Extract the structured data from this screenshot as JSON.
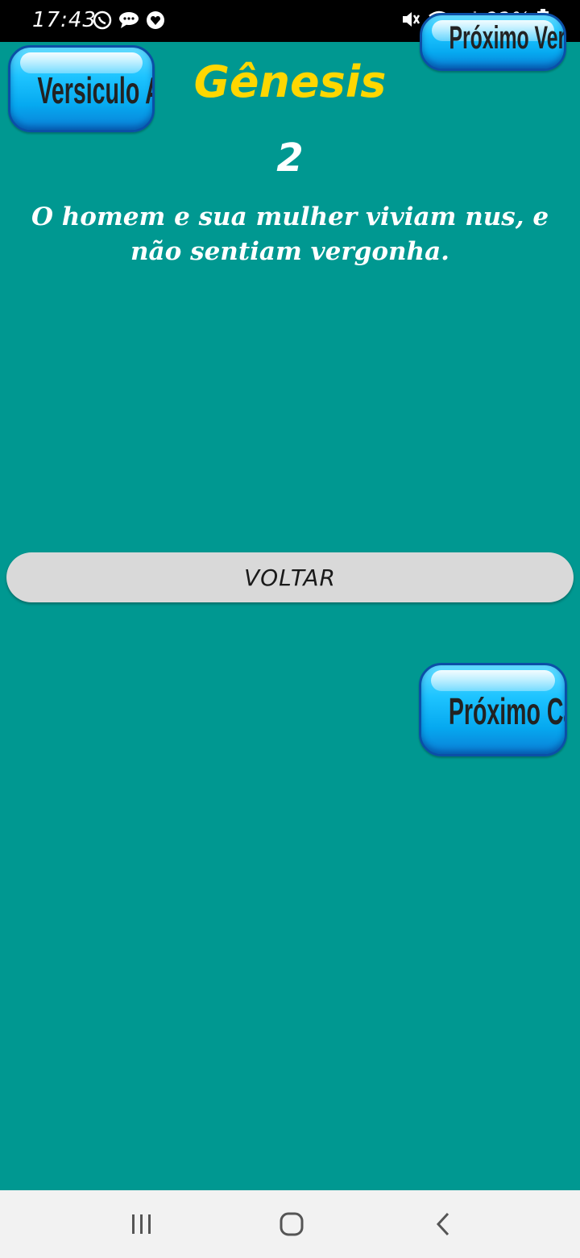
{
  "status_bar": {
    "time": "17:43",
    "battery_percent": "82%",
    "left_icons": [
      "whatsapp-icon",
      "chat-icon",
      "heart-app-icon"
    ],
    "right_icons": [
      "mute-icon",
      "wifi-icon",
      "signal-icon",
      "battery-icon"
    ]
  },
  "header": {
    "book": "Gênesis",
    "verse_number": "2"
  },
  "buttons": {
    "previous_verse": "Versiculo Anterior",
    "next_verse": "Próximo Versículo",
    "next_chapter": "Próximo Capítulo",
    "back": "VOLTAR"
  },
  "verse": {
    "text": "O homem e sua mulher viviam nus, e não sentiam vergonha."
  },
  "nav_bar": {
    "items": [
      "recents-icon",
      "home-icon",
      "back-icon"
    ]
  },
  "colors": {
    "background": "#009891",
    "title": "#ffd700",
    "verse_text": "#ffffff",
    "button_blue": "#1ec4ff",
    "voltar_bg": "#d9d9d9"
  }
}
